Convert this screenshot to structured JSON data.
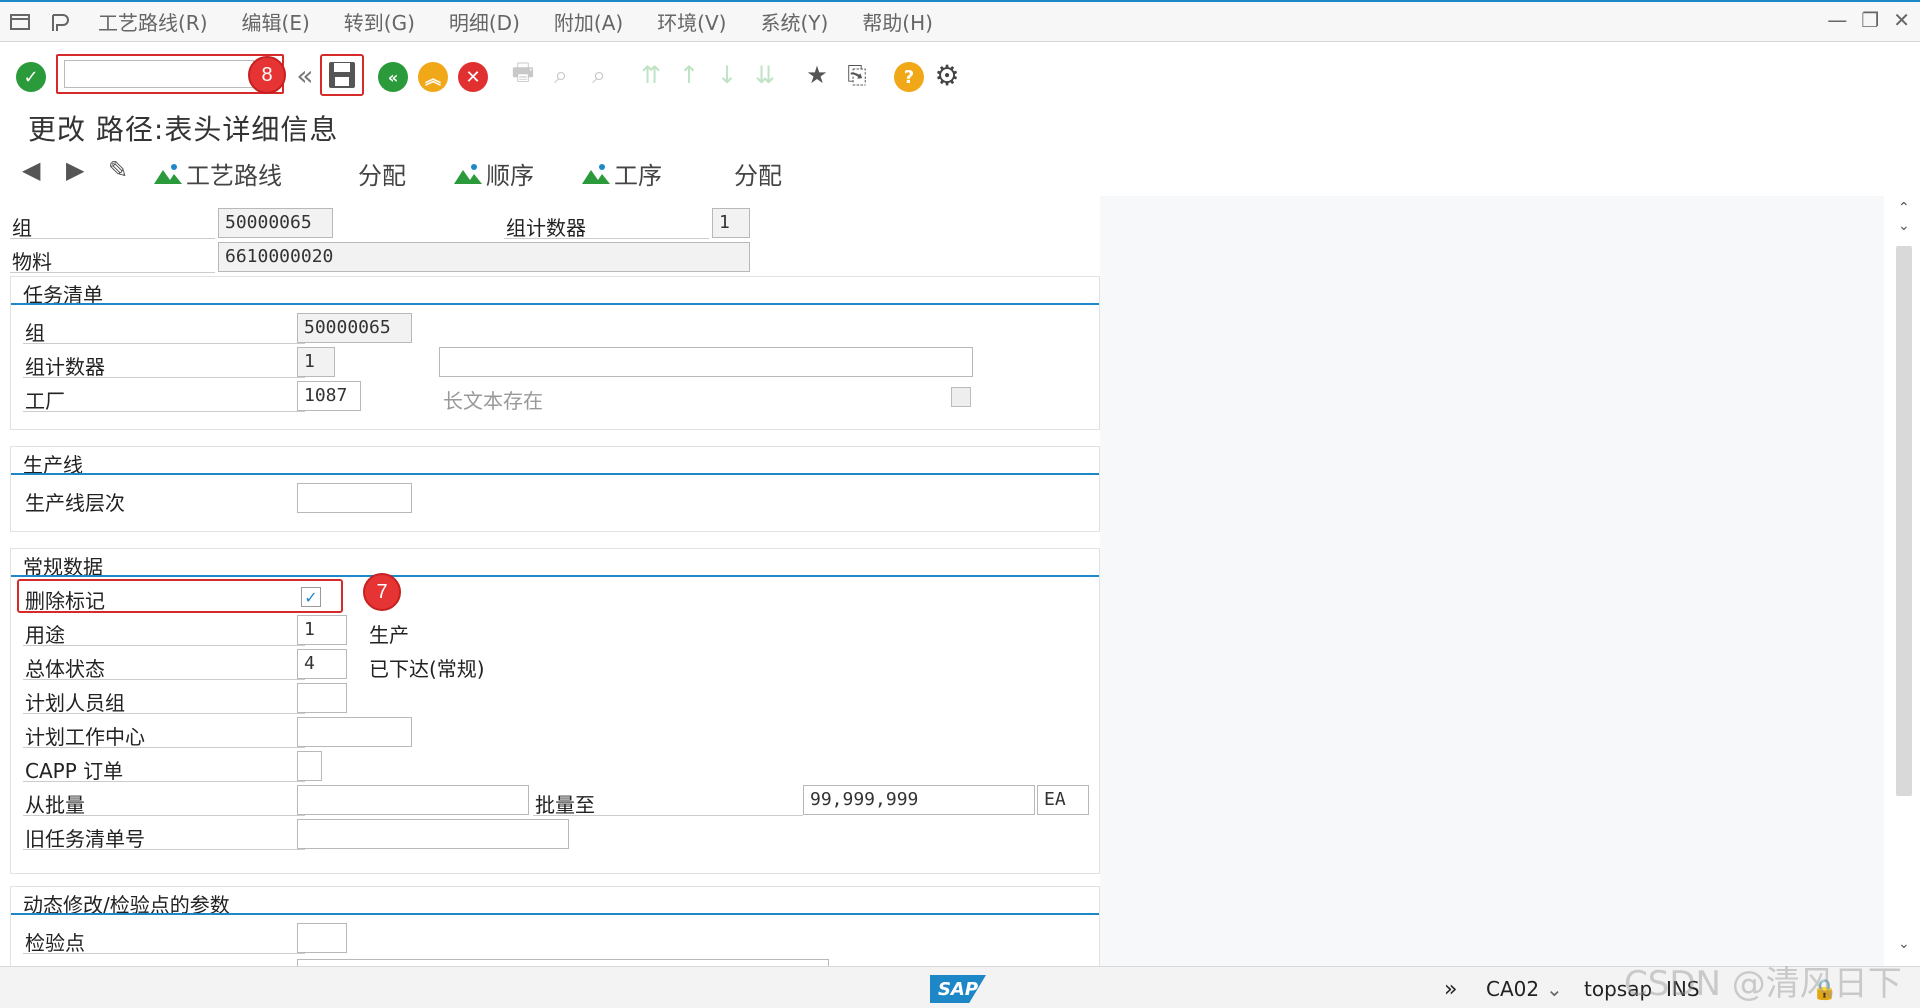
{
  "menubar": {
    "items": [
      "工艺路线(R)",
      "编辑(E)",
      "转到(G)",
      "明细(D)",
      "附加(A)",
      "环境(V)",
      "系统(Y)",
      "帮助(H)"
    ]
  },
  "toolbar": {
    "command_value": "",
    "badge_8": "8",
    "badge_7": "7"
  },
  "title": "更改 路径:表头详细信息",
  "apptb": {
    "routing": "工艺路线",
    "assign1": "分配",
    "sequence": "顺序",
    "operation": "工序",
    "assign2": "分配"
  },
  "header": {
    "group_label": "组",
    "group_value": "50000065",
    "counter_label": "组计数器",
    "counter_value": "1",
    "material_label": "物料",
    "material_value": "6610000020"
  },
  "tasklist": {
    "title": "任务清单",
    "group_label": "组",
    "group_value": "50000065",
    "counter_label": "组计数器",
    "counter_value": "1",
    "description_value": "",
    "plant_label": "工厂",
    "plant_value": "1087",
    "longtext_label": "长文本存在"
  },
  "prodline": {
    "title": "生产线",
    "level_label": "生产线层次",
    "level_value": ""
  },
  "general": {
    "title": "常规数据",
    "deletion_label": "删除标记",
    "deletion_checked": true,
    "usage_label": "用途",
    "usage_value": "1",
    "usage_text": "生产",
    "status_label": "总体状态",
    "status_value": "4",
    "status_text": "已下达(常规)",
    "planner_label": "计划人员组",
    "workcenter_label": "计划工作中心",
    "capp_label": "CAPP 订单",
    "from_lot_label": "从批量",
    "to_lot_label": "批量至",
    "to_lot_value": "99,999,999",
    "unit_value": "EA",
    "old_tasklist_label": "旧任务清单号"
  },
  "dynamic": {
    "title": "动态修改/检验点的参数",
    "inspection_label": "检验点"
  },
  "statusbar": {
    "tcode": "CA02",
    "server": "topsap",
    "mode": "INS",
    "watermark": "CSDN @清风日下"
  }
}
